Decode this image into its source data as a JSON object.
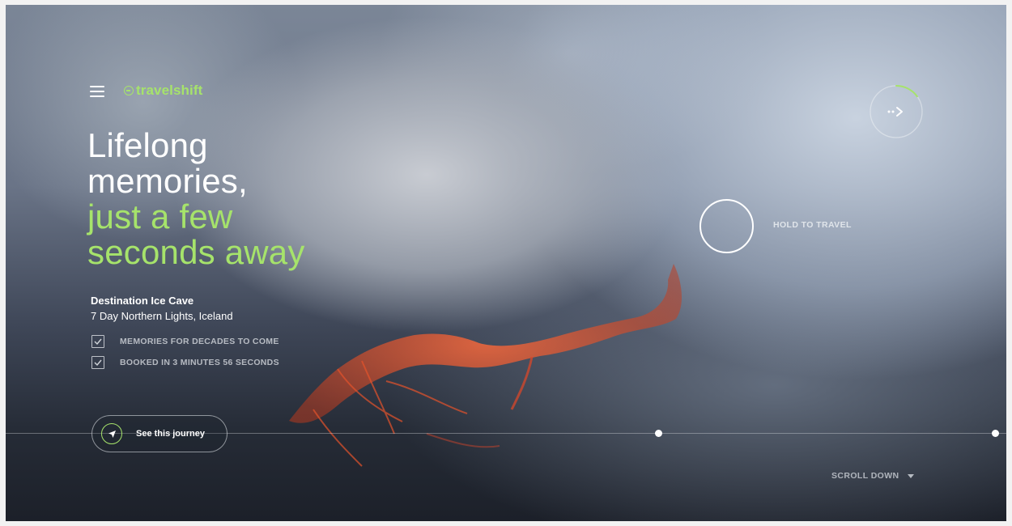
{
  "brand": {
    "logo_text": "travelshift",
    "logo_icon": "clock-arrow-icon",
    "accent_color": "#a6e36b"
  },
  "nav": {
    "menu_icon": "hamburger-menu-icon"
  },
  "hero": {
    "headline_line1": "Lifelong",
    "headline_line2": "memories,",
    "headline_line3": "just a few",
    "headline_line4": "seconds away"
  },
  "destination": {
    "title": "Destination Ice Cave",
    "subtitle": "7 Day Northern Lights, Iceland",
    "features": [
      {
        "label": "MEMORIES FOR DECADES TO COME",
        "checked": true
      },
      {
        "label": "BOOKED IN 3 MINUTES 56 SECONDS",
        "checked": true
      }
    ]
  },
  "actions": {
    "journey_button": "See this journey",
    "journey_icon": "navigation-arrow-icon",
    "hold_label": "HOLD TO TRAVEL",
    "next_icon": "dotted-arrow-right-icon",
    "next_progress": 0.15,
    "scroll_label": "SCROLL DOWN",
    "scroll_icon": "caret-down-icon"
  }
}
